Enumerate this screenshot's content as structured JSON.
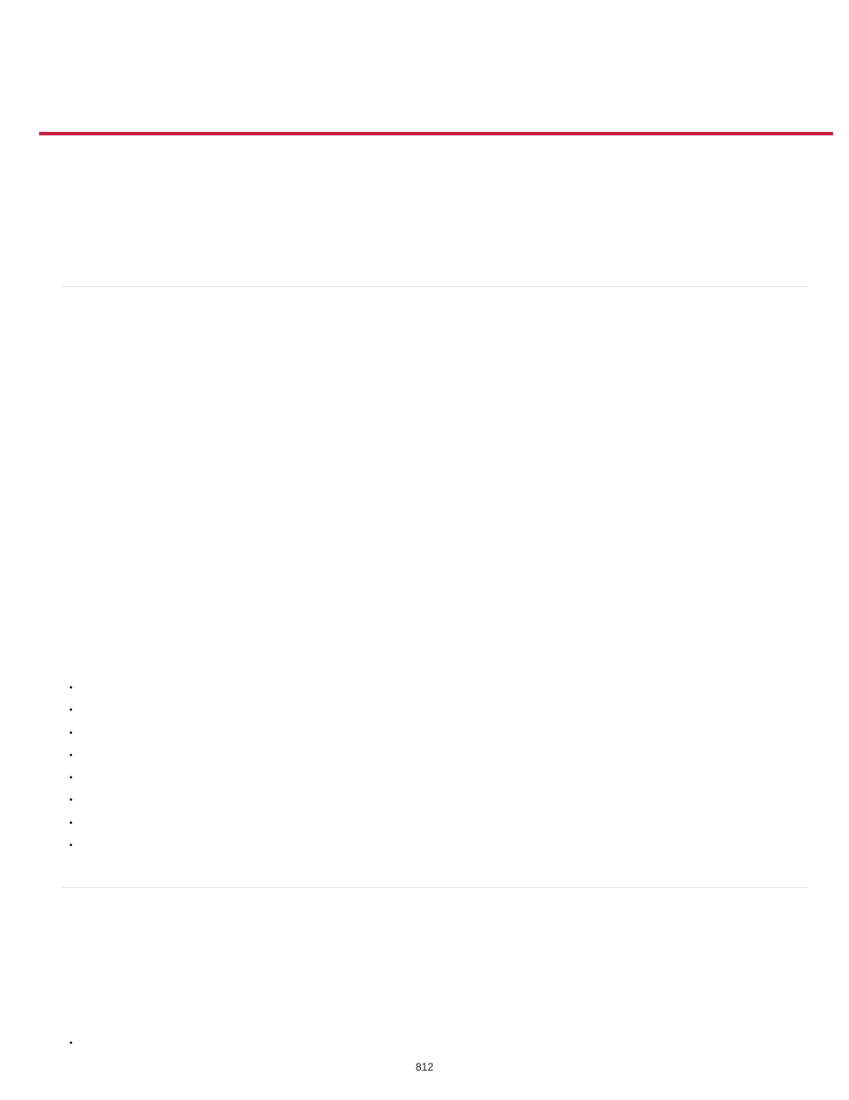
{
  "page_number": "812",
  "bullets_group_1_count": 8,
  "bullets_group_2_count": 1
}
